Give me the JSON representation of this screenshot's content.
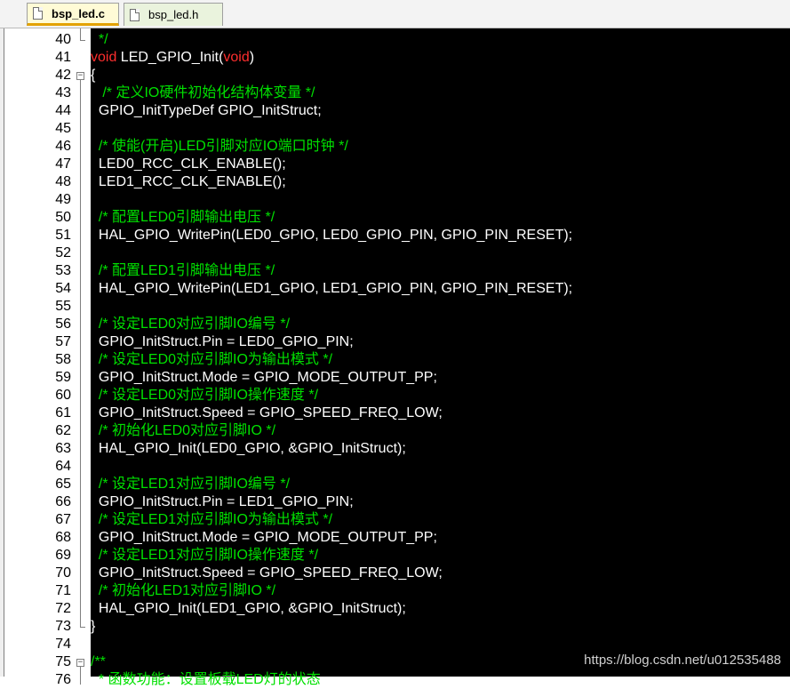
{
  "tabs": [
    {
      "label": "bsp_led.c",
      "active": true
    },
    {
      "label": "bsp_led.h",
      "active": false
    }
  ],
  "colors": {
    "background": "#000000",
    "keyword": "#ff2e2e",
    "comment": "#00e000",
    "plain": "#ffffff",
    "gutter": "#ffffff",
    "active_tab": "#fffbd6",
    "inactive_tab": "#eaf3dd"
  },
  "editor": {
    "lines": [
      {
        "num": "40",
        "tokens": [
          {
            "t": "  */",
            "c": "cm"
          }
        ]
      },
      {
        "num": "41",
        "tokens": [
          {
            "t": "void",
            "c": "kw"
          },
          {
            "t": " LED_GPIO_Init(",
            "c": "pl"
          },
          {
            "t": "void",
            "c": "kw"
          },
          {
            "t": ")",
            "c": "pl"
          }
        ]
      },
      {
        "num": "42",
        "tokens": [
          {
            "t": "{",
            "c": "pl"
          }
        ]
      },
      {
        "num": "43",
        "tokens": [
          {
            "t": "   /* 定义IO硬件初始化结构体变量 */",
            "c": "cm"
          }
        ]
      },
      {
        "num": "44",
        "tokens": [
          {
            "t": "  GPIO_InitTypeDef GPIO_InitStruct;",
            "c": "pl"
          }
        ]
      },
      {
        "num": "45",
        "tokens": []
      },
      {
        "num": "46",
        "tokens": [
          {
            "t": "  /* 使能(开启)LED引脚对应IO端口时钟 */",
            "c": "cm"
          }
        ]
      },
      {
        "num": "47",
        "tokens": [
          {
            "t": "  LED0_RCC_CLK_ENABLE();",
            "c": "pl"
          }
        ]
      },
      {
        "num": "48",
        "tokens": [
          {
            "t": "  LED1_RCC_CLK_ENABLE();",
            "c": "pl"
          }
        ]
      },
      {
        "num": "49",
        "tokens": []
      },
      {
        "num": "50",
        "tokens": [
          {
            "t": "  /* 配置LED0引脚输出电压 */",
            "c": "cm"
          }
        ]
      },
      {
        "num": "51",
        "tokens": [
          {
            "t": "  HAL_GPIO_WritePin(LED0_GPIO, LED0_GPIO_PIN, GPIO_PIN_RESET);",
            "c": "pl"
          }
        ]
      },
      {
        "num": "52",
        "tokens": []
      },
      {
        "num": "53",
        "tokens": [
          {
            "t": "  /* 配置LED1引脚输出电压 */",
            "c": "cm"
          }
        ]
      },
      {
        "num": "54",
        "tokens": [
          {
            "t": "  HAL_GPIO_WritePin(LED1_GPIO, LED1_GPIO_PIN, GPIO_PIN_RESET);",
            "c": "pl"
          }
        ]
      },
      {
        "num": "55",
        "tokens": []
      },
      {
        "num": "56",
        "tokens": [
          {
            "t": "  /* 设定LED0对应引脚IO编号 */",
            "c": "cm"
          }
        ]
      },
      {
        "num": "57",
        "tokens": [
          {
            "t": "  GPIO_InitStruct.Pin = LED0_GPIO_PIN;",
            "c": "pl"
          }
        ]
      },
      {
        "num": "58",
        "tokens": [
          {
            "t": "  /* 设定LED0对应引脚IO为输出模式 */",
            "c": "cm"
          }
        ]
      },
      {
        "num": "59",
        "tokens": [
          {
            "t": "  GPIO_InitStruct.Mode = GPIO_MODE_OUTPUT_PP;",
            "c": "pl"
          }
        ]
      },
      {
        "num": "60",
        "tokens": [
          {
            "t": "  /* 设定LED0对应引脚IO操作速度 */",
            "c": "cm"
          }
        ]
      },
      {
        "num": "61",
        "tokens": [
          {
            "t": "  GPIO_InitStruct.Speed = GPIO_SPEED_FREQ_LOW;",
            "c": "pl"
          }
        ]
      },
      {
        "num": "62",
        "tokens": [
          {
            "t": "  /* 初始化LED0对应引脚IO */",
            "c": "cm"
          }
        ]
      },
      {
        "num": "63",
        "tokens": [
          {
            "t": "  HAL_GPIO_Init(LED0_GPIO, &GPIO_InitStruct);",
            "c": "pl"
          }
        ]
      },
      {
        "num": "64",
        "tokens": []
      },
      {
        "num": "65",
        "tokens": [
          {
            "t": "  /* 设定LED1对应引脚IO编号 */",
            "c": "cm"
          }
        ]
      },
      {
        "num": "66",
        "tokens": [
          {
            "t": "  GPIO_InitStruct.Pin = LED1_GPIO_PIN;",
            "c": "pl"
          }
        ]
      },
      {
        "num": "67",
        "tokens": [
          {
            "t": "  /* 设定LED1对应引脚IO为输出模式 */",
            "c": "cm"
          }
        ]
      },
      {
        "num": "68",
        "tokens": [
          {
            "t": "  GPIO_InitStruct.Mode = GPIO_MODE_OUTPUT_PP;",
            "c": "pl"
          }
        ]
      },
      {
        "num": "69",
        "tokens": [
          {
            "t": "  /* 设定LED1对应引脚IO操作速度 */",
            "c": "cm"
          }
        ]
      },
      {
        "num": "70",
        "tokens": [
          {
            "t": "  GPIO_InitStruct.Speed = GPIO_SPEED_FREQ_LOW;",
            "c": "pl"
          }
        ]
      },
      {
        "num": "71",
        "tokens": [
          {
            "t": "  /* 初始化LED1对应引脚IO */",
            "c": "cm"
          }
        ]
      },
      {
        "num": "72",
        "tokens": [
          {
            "t": "  HAL_GPIO_Init(LED1_GPIO, &GPIO_InitStruct);",
            "c": "pl"
          }
        ]
      },
      {
        "num": "73",
        "tokens": [
          {
            "t": "}",
            "c": "pl"
          }
        ]
      },
      {
        "num": "74",
        "tokens": []
      },
      {
        "num": "75",
        "tokens": [
          {
            "t": "/**",
            "c": "cm"
          }
        ]
      },
      {
        "num": "76",
        "tokens": [
          {
            "t": "  * 函数功能：设置板载LED灯的状态",
            "c": "cm"
          }
        ]
      }
    ]
  },
  "watermark": "https://blog.csdn.net/u012535488"
}
